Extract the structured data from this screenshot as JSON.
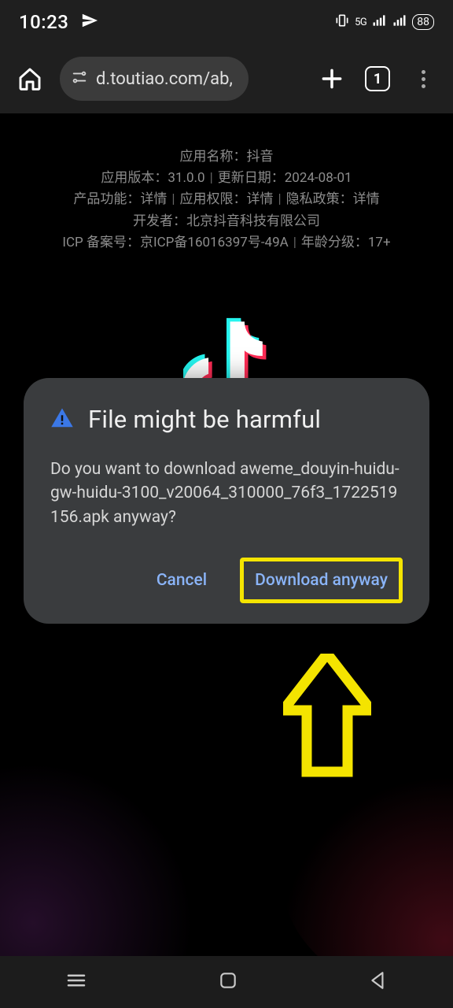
{
  "status": {
    "time": "10:23",
    "network_5g": "5G",
    "battery": "88"
  },
  "toolbar": {
    "url": "d.toutiao.com/ab,",
    "tab_count": "1"
  },
  "page": {
    "meta": {
      "line1a": "应用名称：抖音",
      "line2a": "应用版本：31.0.0",
      "line2b": "更新日期：2024-08-01",
      "line3a": "产品功能：详情",
      "line3b": "应用权限：详情",
      "line3c": "隐私政策：详情",
      "line4a": "开发者：北京抖音科技有限公司",
      "line5a": "ICP 备案号：京ICP备16016397号-49A",
      "line5b": "年龄分级：17+"
    }
  },
  "dialog": {
    "title": "File might be harmful",
    "body_prefix": "Do you want to download ",
    "filename": "aweme_douyin-huidu-gw-huidu-3100_v20064_310000_76f3_1722519156.apk",
    "body_suffix": " anyway?",
    "cancel": "Cancel",
    "confirm": "Download anyway"
  }
}
